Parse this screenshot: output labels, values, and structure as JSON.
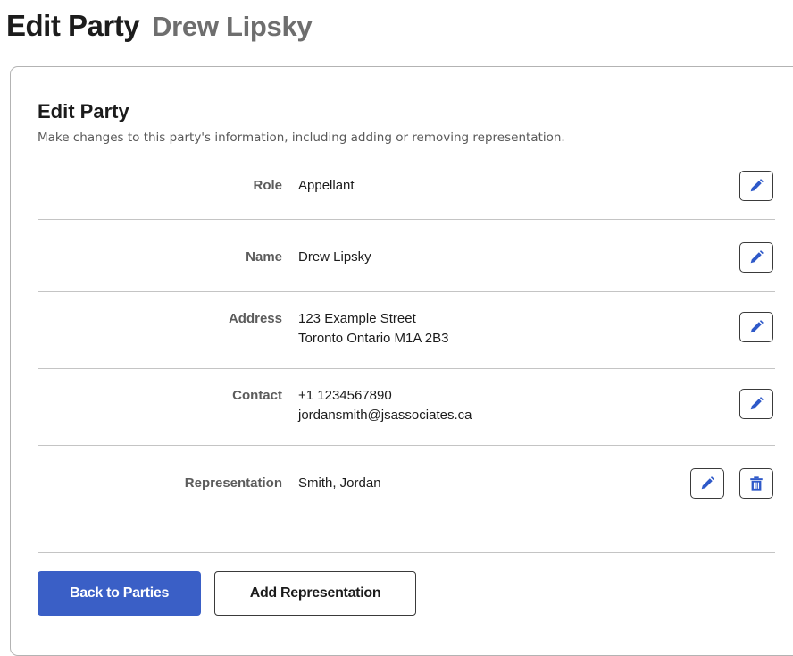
{
  "header": {
    "title": "Edit Party",
    "subtitle": "Drew Lipsky"
  },
  "card": {
    "title": "Edit Party",
    "description": "Make changes to this party's information, including adding or removing representation."
  },
  "rows": [
    {
      "label": "Role",
      "lines": [
        "Appellant"
      ]
    },
    {
      "label": "Name",
      "lines": [
        "Drew Lipsky"
      ]
    },
    {
      "label": "Address",
      "lines": [
        "123 Example Street",
        "Toronto Ontario M1A 2B3"
      ]
    },
    {
      "label": "Contact",
      "lines": [
        "+1 1234567890",
        "jordansmith@jsassociates.ca"
      ]
    },
    {
      "label": "Representation",
      "lines": [
        "Smith, Jordan"
      ]
    }
  ],
  "buttons": {
    "back": "Back to Parties",
    "add": "Add Representation"
  },
  "icons": {
    "edit": "pencil-icon",
    "delete": "trash-icon"
  },
  "colors": {
    "primary": "#3a5fc6",
    "pencil": "#2e59c9"
  }
}
